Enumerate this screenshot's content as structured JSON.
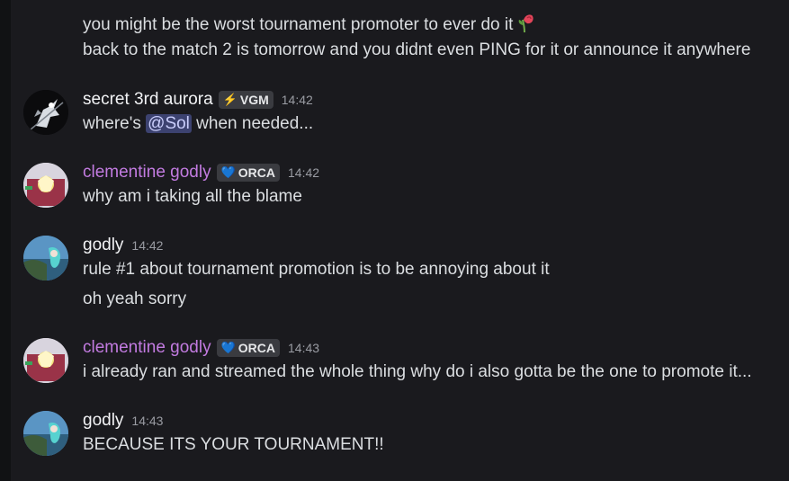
{
  "messages": [
    {
      "lines": [
        "you might be the worst tournament promoter to ever do it",
        "back to the match 2 is tomorrow and you didnt even PING for it or announce it anywhere"
      ],
      "emoji": "wilted-rose-icon"
    },
    {
      "author": "secret 3rd aurora",
      "badge": {
        "icon": "⚡",
        "label": "VGM"
      },
      "time": "14:42",
      "text_before": "where's ",
      "mention": "@Sol",
      "text_after": " when needed..."
    },
    {
      "author": "clementine godly",
      "badge": {
        "icon": "💙",
        "label": "ORCA"
      },
      "time": "14:42",
      "lines": [
        "why am i taking all the blame"
      ]
    },
    {
      "author": "godly",
      "time": "14:42",
      "lines": [
        "rule #1 about tournament promotion is to be annoying about it",
        "oh yeah sorry"
      ]
    },
    {
      "author": "clementine godly",
      "badge": {
        "icon": "💙",
        "label": "ORCA"
      },
      "time": "14:43",
      "lines": [
        "i already ran and streamed the whole thing why do i also gotta be the one to promote it..."
      ]
    },
    {
      "author": "godly",
      "time": "14:43",
      "lines": [
        "BECAUSE ITS YOUR TOURNAMENT!!"
      ]
    }
  ],
  "colors": {
    "background": "#1a1a1e",
    "role_color_purple": "#c27be0",
    "mention_bg": "#3c4270",
    "timestamp": "#9a9ca3"
  }
}
